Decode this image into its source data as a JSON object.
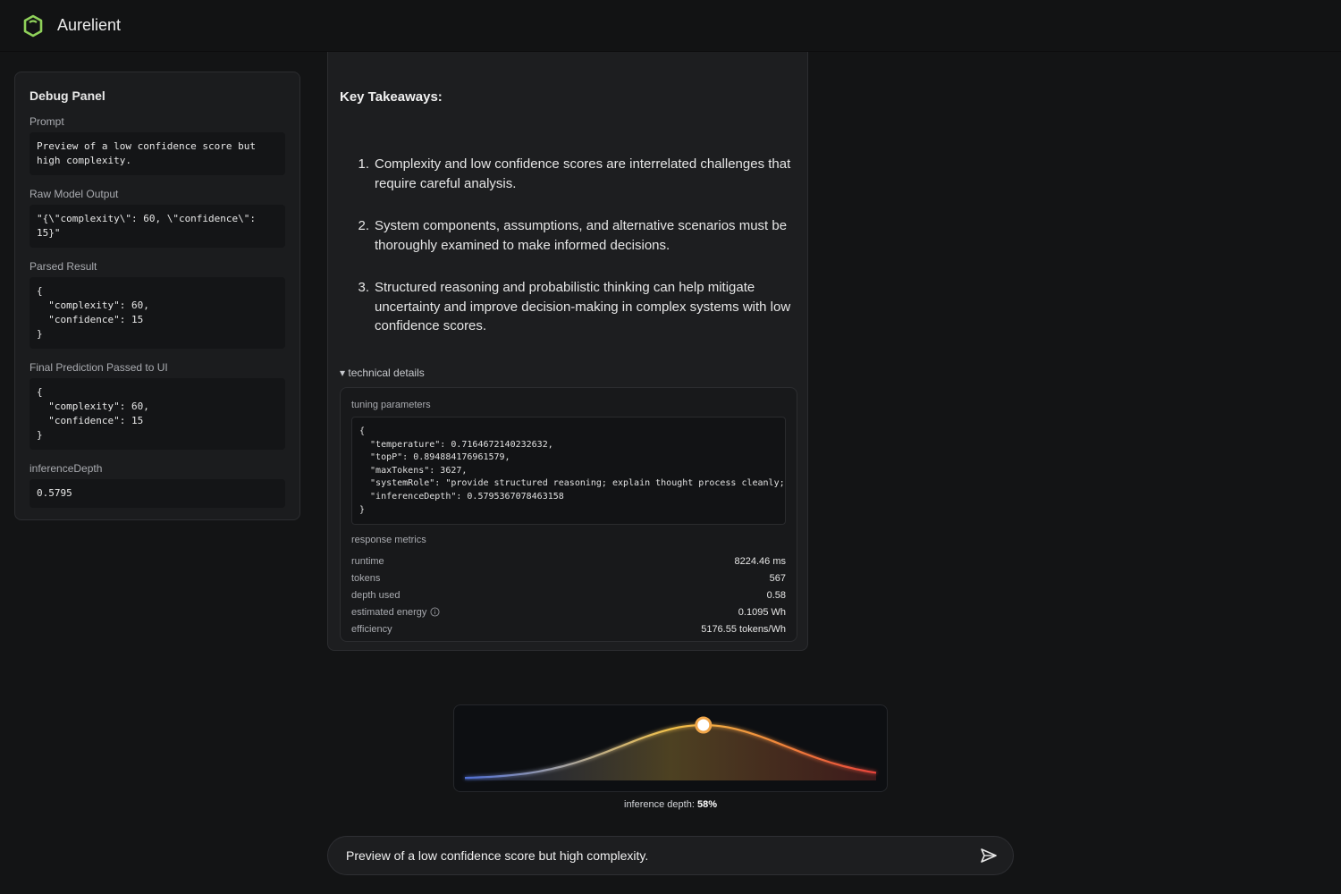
{
  "app": {
    "brand": "Aurelient"
  },
  "debug": {
    "title": "Debug Panel",
    "prompt_label": "Prompt",
    "prompt": "Preview of a low confidence score but high complexity.",
    "raw_label": "Raw Model Output",
    "raw": "\"{\\\"complexity\\\": 60, \\\"confidence\\\": 15}\"",
    "parsed_label": "Parsed Result",
    "parsed": "{\n  \"complexity\": 60,\n  \"confidence\": 15\n}",
    "final_label": "Final Prediction Passed to UI",
    "final": "{\n  \"complexity\": 60,\n  \"confidence\": 15\n}",
    "depth_label": "inferenceDepth",
    "depth": "0.5795"
  },
  "response": {
    "heading": "Key Takeaways:",
    "items": [
      {
        "num": "1.",
        "text": "Complexity and low confidence scores are interrelated challenges that require careful analysis."
      },
      {
        "num": "2.",
        "text": "System components, assumptions, and alternative scenarios must be thoroughly examined to make informed decisions."
      },
      {
        "num": "3.",
        "text": "Structured reasoning and probabilistic thinking can help mitigate uncertainty and improve decision-making in complex systems with low confidence scores."
      }
    ]
  },
  "technical": {
    "toggle_label": "▾ technical details",
    "tuning_label": "tuning parameters",
    "tuning_json": "{\n  \"temperature\": 0.7164672140232632,\n  \"topP\": 0.894884176961579,\n  \"maxTokens\": 3627,\n  \"systemRole\": \"provide structured reasoning; explain thought process cleanly;\n  \"inferenceDepth\": 0.5795367078463158\n}",
    "metrics_label": "response metrics",
    "metrics": [
      {
        "name": "runtime",
        "value": "8224.46 ms"
      },
      {
        "name": "tokens",
        "value": "567"
      },
      {
        "name": "depth used",
        "value": "0.58"
      },
      {
        "name": "estimated energy",
        "value": "0.1095 Wh"
      },
      {
        "name": "efficiency",
        "value": "5176.55 tokens/Wh"
      }
    ]
  },
  "depth_meter": {
    "label": "inference depth:",
    "value_text": "58%",
    "value": 0.58,
    "colors": {
      "low": "#4f6fd6",
      "mid": "#f2c24a",
      "high": "#e8433a"
    }
  },
  "composer": {
    "value": "Preview of a low confidence score but high complexity.",
    "send_icon": "send-icon"
  }
}
